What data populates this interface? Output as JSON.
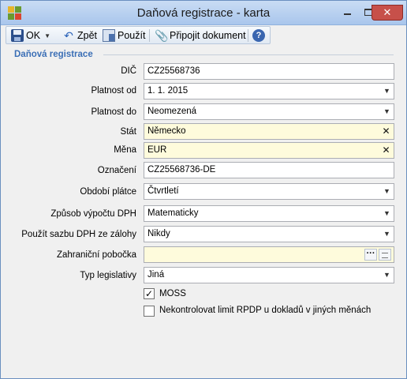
{
  "window": {
    "title": "Daňová registrace - karta"
  },
  "toolbar": {
    "ok_label": "OK",
    "back_label": "Zpět",
    "use_label": "Použít",
    "attach_label": "Připojit dokument"
  },
  "section": {
    "title": "Daňová registrace"
  },
  "fields": {
    "dic": {
      "label": "DIČ",
      "value": "CZ25568736"
    },
    "platnost_od": {
      "label": "Platnost od",
      "value": "1. 1. 2015"
    },
    "platnost_do": {
      "label": "Platnost do",
      "value": "Neomezená"
    },
    "stat": {
      "label": "Stát",
      "value": "Německo"
    },
    "mena": {
      "label": "Měna",
      "value": "EUR"
    },
    "oznaceni": {
      "label": "Označení",
      "value": "CZ25568736-DE"
    },
    "obdobi": {
      "label": "Období plátce",
      "value": "Čtvrtletí"
    },
    "zpusob": {
      "label": "Způsob výpočtu DPH",
      "value": "Matematicky"
    },
    "sazba": {
      "label": "Použít sazbu DPH ze zálohy",
      "value": "Nikdy"
    },
    "pobocka": {
      "label": "Zahraniční pobočka",
      "value": ""
    },
    "legislativa": {
      "label": "Typ legislativy",
      "value": "Jiná"
    }
  },
  "checks": {
    "moss": {
      "label": "MOSS",
      "checked": true
    },
    "nekontrolovat": {
      "label": "Nekontrolovat limit RPDP u dokladů v jiných měnách",
      "checked": false
    }
  },
  "colors": {
    "required_bg": "#fefbdc",
    "section_title": "#3b6fb6",
    "close_button": "#c7504a"
  }
}
